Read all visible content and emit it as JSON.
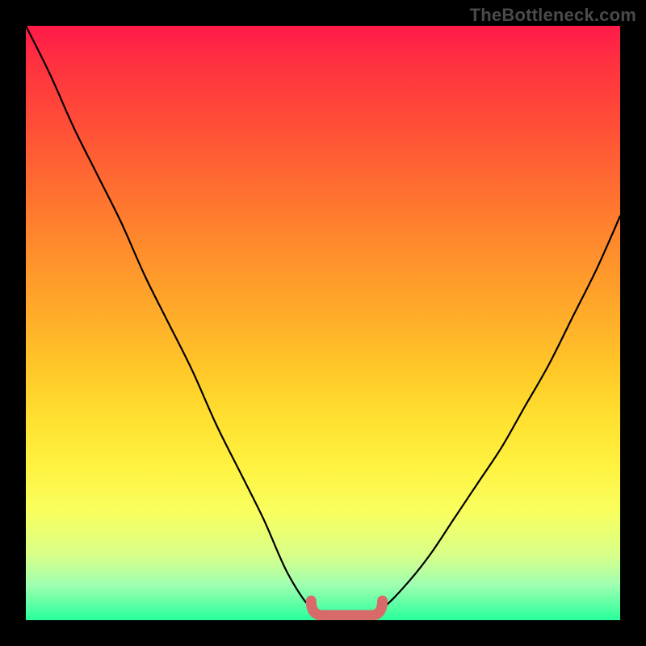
{
  "watermark": "TheBottleneck.com",
  "colors": {
    "frame": "#000000",
    "curve": "#000000",
    "hump": "#d86a6a",
    "gradient_stops": [
      "#ff1a4a",
      "#ff3040",
      "#ff5236",
      "#ff7030",
      "#ff8e2c",
      "#ffaa2a",
      "#ffc828",
      "#ffe030",
      "#fff240",
      "#f8ff60",
      "#d8ff88",
      "#a0ffb0",
      "#28ff9c"
    ]
  },
  "chart_data": {
    "type": "line",
    "title": "",
    "xlabel": "",
    "ylabel": "",
    "xlim": [
      0,
      100
    ],
    "ylim": [
      0,
      100
    ],
    "x": [
      0,
      4,
      8,
      12,
      16,
      20,
      24,
      28,
      32,
      36,
      40,
      44,
      48,
      52,
      56,
      60,
      64,
      68,
      72,
      76,
      80,
      84,
      88,
      92,
      96,
      100
    ],
    "values": [
      100,
      92,
      83,
      75,
      67,
      58,
      50,
      42,
      33,
      25,
      17,
      8,
      2,
      0,
      0,
      2,
      6,
      11,
      17,
      23,
      29,
      36,
      43,
      51,
      59,
      68
    ],
    "flat_region": {
      "x_start": 48,
      "x_end": 60,
      "y": 0
    },
    "annotations": []
  }
}
